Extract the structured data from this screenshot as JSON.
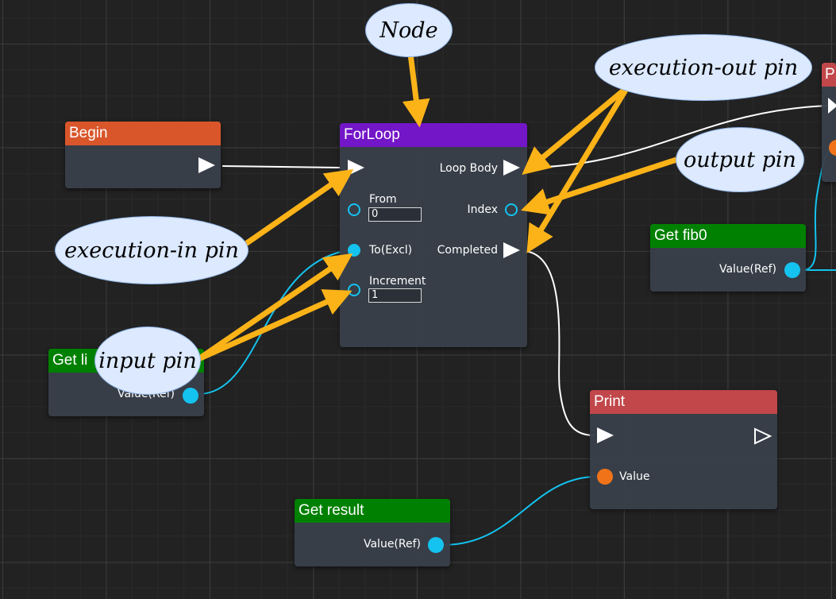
{
  "colors": {
    "exec_header": "#d9562b",
    "forloop_header": "#7316c7",
    "get_header": "#008000",
    "print_header": "#c1474a",
    "data_pin": "#14c3ef",
    "value_pin": "#f0731a",
    "callout_fill": "#dce9ff",
    "arrow": "#fcb318"
  },
  "nodes": {
    "begin": {
      "title": "Begin"
    },
    "forloop": {
      "title": "ForLoop",
      "loop_body": "Loop Body",
      "from_label": "From",
      "from_value": "0",
      "index": "Index",
      "to_label": "To(Excl)",
      "completed": "Completed",
      "increment_label": "Increment",
      "increment_value": "1"
    },
    "get_limit": {
      "title": "Get li",
      "value": "Value(Ref)"
    },
    "get_fib0": {
      "title": "Get fib0",
      "value": "Value(Ref)"
    },
    "print": {
      "title": "Print",
      "value": "Value"
    },
    "get_result": {
      "title": "Get result",
      "value": "Value(Ref)"
    },
    "print_partial": {
      "title": "P"
    }
  },
  "callouts": {
    "node": "Node",
    "exec_out": "execution-out pin",
    "output": "output pin",
    "exec_in": "execution-in pin",
    "input": "input pin"
  },
  "icons": {
    "exec_pin": "play-triangle-icon",
    "exec_pin_unconnected": "outline-triangle-icon",
    "data_pin": "circle-pin-icon"
  }
}
